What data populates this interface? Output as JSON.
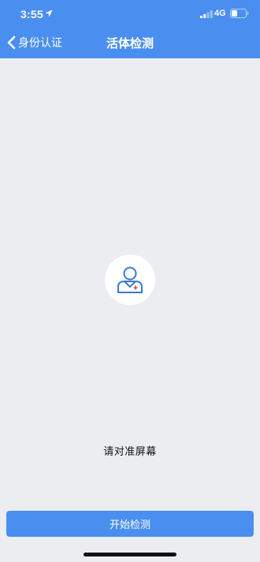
{
  "status_bar": {
    "time": "3:55",
    "network": "4G",
    "icons": [
      "location-arrow-icon",
      "cellular-signal-icon",
      "battery-icon"
    ]
  },
  "nav": {
    "back_label": "身份认证",
    "title": "活体检测",
    "icons": [
      "chevron-left-icon"
    ]
  },
  "main": {
    "avatar_icon": "user-profile-icon",
    "instruction": "请对准屏幕"
  },
  "footer": {
    "start_button": "开始检测"
  },
  "colors": {
    "primary": "#4a8ff0",
    "background": "#ecedf1",
    "text": "#111111"
  }
}
